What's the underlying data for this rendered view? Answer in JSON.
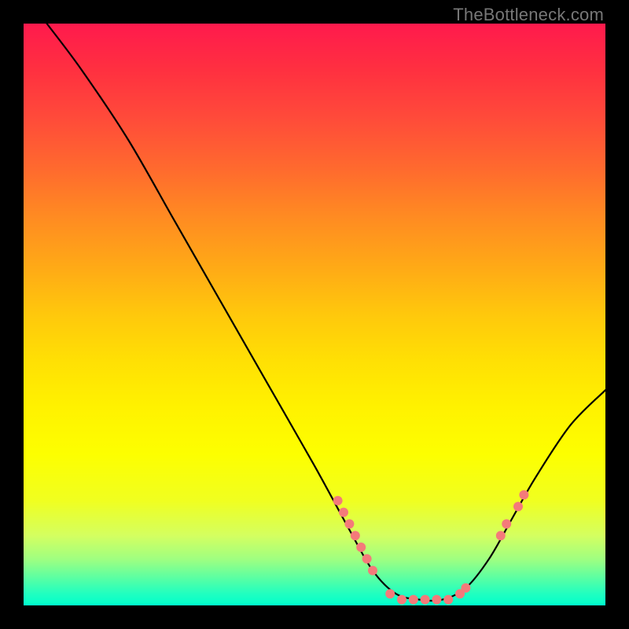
{
  "watermark": "TheBottleneck.com",
  "chart_data": {
    "type": "line",
    "title": "",
    "xlabel": "",
    "ylabel": "",
    "xlim": [
      0,
      100
    ],
    "ylim": [
      0,
      100
    ],
    "grid": false,
    "curve": [
      {
        "x": 4,
        "y": 100
      },
      {
        "x": 10,
        "y": 92
      },
      {
        "x": 18,
        "y": 80
      },
      {
        "x": 26,
        "y": 66
      },
      {
        "x": 34,
        "y": 52
      },
      {
        "x": 42,
        "y": 38
      },
      {
        "x": 50,
        "y": 24
      },
      {
        "x": 56,
        "y": 13
      },
      {
        "x": 60,
        "y": 6
      },
      {
        "x": 64,
        "y": 2
      },
      {
        "x": 68,
        "y": 1
      },
      {
        "x": 72,
        "y": 1
      },
      {
        "x": 76,
        "y": 3
      },
      {
        "x": 80,
        "y": 8
      },
      {
        "x": 84,
        "y": 15
      },
      {
        "x": 88,
        "y": 22
      },
      {
        "x": 94,
        "y": 31
      },
      {
        "x": 100,
        "y": 37
      }
    ],
    "markers": [
      {
        "x": 54,
        "y": 18
      },
      {
        "x": 55,
        "y": 16
      },
      {
        "x": 56,
        "y": 14
      },
      {
        "x": 57,
        "y": 12
      },
      {
        "x": 58,
        "y": 10
      },
      {
        "x": 59,
        "y": 8
      },
      {
        "x": 60,
        "y": 6
      },
      {
        "x": 63,
        "y": 2
      },
      {
        "x": 65,
        "y": 1
      },
      {
        "x": 67,
        "y": 1
      },
      {
        "x": 69,
        "y": 1
      },
      {
        "x": 71,
        "y": 1
      },
      {
        "x": 73,
        "y": 1
      },
      {
        "x": 75,
        "y": 2
      },
      {
        "x": 76,
        "y": 3
      },
      {
        "x": 82,
        "y": 12
      },
      {
        "x": 83,
        "y": 14
      },
      {
        "x": 85,
        "y": 17
      },
      {
        "x": 86,
        "y": 19
      }
    ],
    "marker_color": "#f47a7a",
    "marker_radius": 6
  }
}
